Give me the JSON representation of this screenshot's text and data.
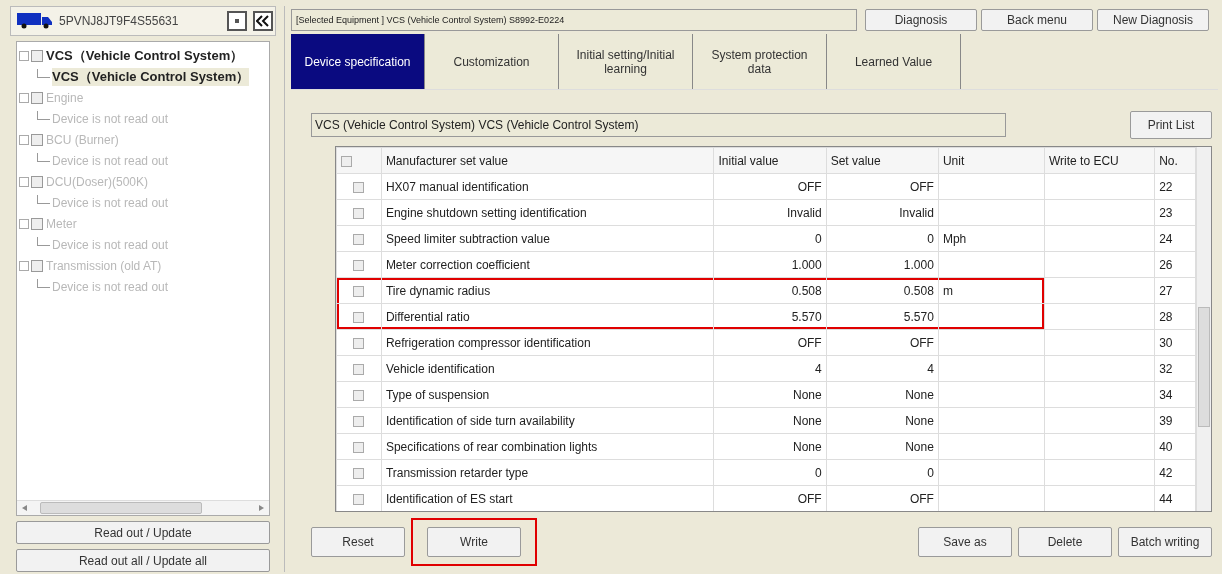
{
  "vehicle": {
    "vin": "5PVNJ8JT9F4S55631"
  },
  "tree": [
    {
      "label": "VCS（Vehicle Control System）",
      "disabled": false,
      "children": [
        {
          "label": "VCS（Vehicle Control System）",
          "selected": true,
          "disabled": false
        }
      ]
    },
    {
      "label": "Engine",
      "disabled": true,
      "children": [
        {
          "label": "Device is not read out",
          "selected": false,
          "disabled": true
        }
      ]
    },
    {
      "label": "BCU (Burner)",
      "disabled": true,
      "children": [
        {
          "label": "Device is not read out",
          "selected": false,
          "disabled": true
        }
      ]
    },
    {
      "label": "DCU(Doser)(500K)",
      "disabled": true,
      "children": [
        {
          "label": "Device is not read out",
          "selected": false,
          "disabled": true
        }
      ]
    },
    {
      "label": "Meter",
      "disabled": true,
      "children": [
        {
          "label": "Device is not read out",
          "selected": false,
          "disabled": true
        }
      ]
    },
    {
      "label": "Transmission (old AT)",
      "disabled": true,
      "children": [
        {
          "label": "Device is not read out",
          "selected": false,
          "disabled": true
        }
      ]
    }
  ],
  "left_buttons": [
    "Read out / Update",
    "Read out all / Update all"
  ],
  "selected_equipment": "[Selected Equipment ] VCS (Vehicle Control System) S8992-E0224",
  "top_buttons": [
    "Diagnosis",
    "Back menu",
    "New Diagnosis"
  ],
  "tabs": [
    {
      "label": "Device specification",
      "selected": true
    },
    {
      "label": "Customization",
      "selected": false
    },
    {
      "label": "Initial setting/Initial learning",
      "selected": false
    },
    {
      "label": "System protection data",
      "selected": false
    },
    {
      "label": "Learned Value",
      "selected": false
    }
  ],
  "system_field": "VCS (Vehicle Control System) VCS (Vehicle Control System)",
  "print_button": "Print List",
  "table": {
    "all_checked": false,
    "columns": [
      "Manufacturer set value",
      "Initial value",
      "Set value",
      "Unit",
      "Write to ECU",
      "No."
    ],
    "rows": [
      {
        "checked": false,
        "highlighted": false,
        "cells": [
          "HX07 manual identification",
          "OFF",
          "OFF",
          "",
          "",
          "22"
        ]
      },
      {
        "checked": false,
        "highlighted": false,
        "cells": [
          "Engine shutdown setting identification",
          "Invalid",
          "Invalid",
          "",
          "",
          "23"
        ]
      },
      {
        "checked": false,
        "highlighted": false,
        "cells": [
          "Speed limiter subtraction value",
          "0",
          "0",
          "Mph",
          "",
          "24"
        ]
      },
      {
        "checked": false,
        "highlighted": false,
        "cells": [
          "Meter correction coefficient",
          "1.000",
          "1.000",
          "",
          "",
          "26"
        ]
      },
      {
        "checked": false,
        "highlighted": true,
        "cells": [
          "Tire dynamic radius",
          "0.508",
          "0.508",
          "m",
          "",
          "27"
        ]
      },
      {
        "checked": false,
        "highlighted": true,
        "cells": [
          "Differential ratio",
          "5.570",
          "5.570",
          "",
          "",
          "28"
        ]
      },
      {
        "checked": false,
        "highlighted": false,
        "cells": [
          "Refrigeration compressor identification",
          "OFF",
          "OFF",
          "",
          "",
          "30"
        ]
      },
      {
        "checked": false,
        "highlighted": false,
        "cells": [
          "Vehicle identification",
          "4",
          "4",
          "",
          "",
          "32"
        ]
      },
      {
        "checked": false,
        "highlighted": false,
        "cells": [
          "Type of suspension",
          "None",
          "None",
          "",
          "",
          "34"
        ]
      },
      {
        "checked": false,
        "highlighted": false,
        "cells": [
          "Identification of side turn availability",
          "None",
          "None",
          "",
          "",
          "39"
        ]
      },
      {
        "checked": false,
        "highlighted": false,
        "cells": [
          "Specifications of rear combination lights",
          "None",
          "None",
          "",
          "",
          "40"
        ]
      },
      {
        "checked": false,
        "highlighted": false,
        "cells": [
          "Transmission retarder type",
          "0",
          "0",
          "",
          "",
          "42"
        ]
      },
      {
        "checked": false,
        "highlighted": false,
        "cells": [
          "Identification of ES start",
          "OFF",
          "OFF",
          "",
          "",
          "44"
        ]
      }
    ]
  },
  "bottom_left_buttons": [
    {
      "label": "Reset",
      "highlighted": false
    },
    {
      "label": "Write",
      "highlighted": true
    }
  ],
  "bottom_right_buttons": [
    "Save as",
    "Delete",
    "Batch writing"
  ]
}
